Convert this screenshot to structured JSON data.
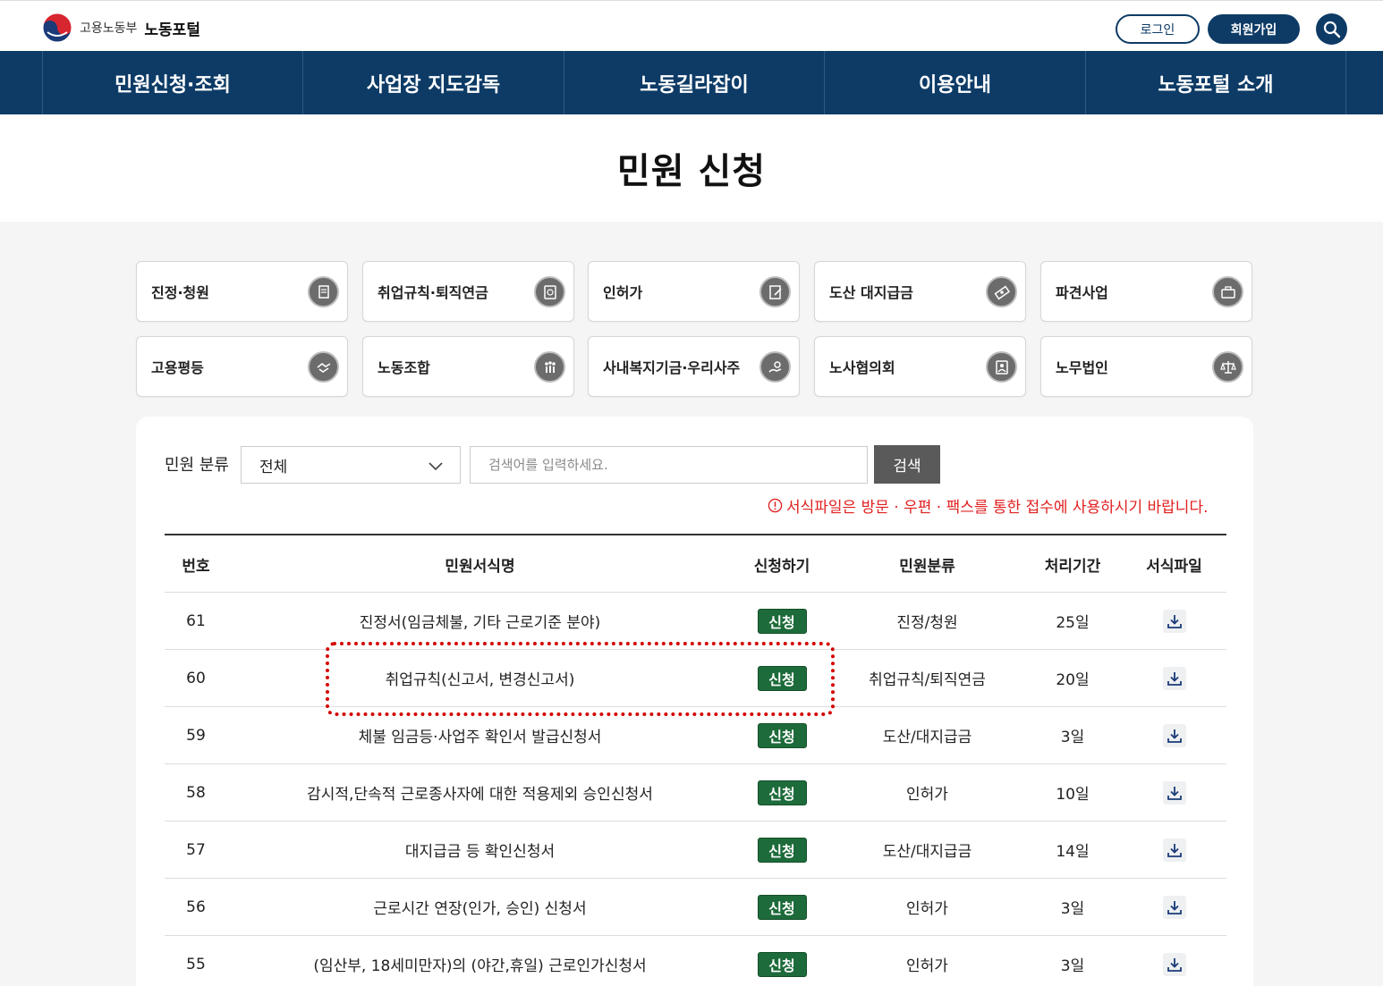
{
  "header": {
    "ministry": "고용노동부",
    "portal": "노동포털",
    "login_label": "로그인",
    "join_label": "회원가입",
    "search_icon": "search-icon"
  },
  "gnb": [
    "민원신청·조회",
    "사업장 지도감독",
    "노동길라잡이",
    "이용안내",
    "노동포털 소개"
  ],
  "page_title": "민원 신청",
  "categories": [
    {
      "label": "진정·청원",
      "icon": "petition-icon"
    },
    {
      "label": "취업규칙·퇴직연금",
      "icon": "rules-icon"
    },
    {
      "label": "인허가",
      "icon": "permit-icon"
    },
    {
      "label": "도산 대지급금",
      "icon": "money-icon"
    },
    {
      "label": "파견사업",
      "icon": "briefcase-icon"
    },
    {
      "label": "고용평등",
      "icon": "handshake-icon"
    },
    {
      "label": "노동조합",
      "icon": "union-icon"
    },
    {
      "label": "사내복지기금·우리사주",
      "icon": "welfare-icon"
    },
    {
      "label": "노사협의회",
      "icon": "council-icon"
    },
    {
      "label": "노무법인",
      "icon": "scale-icon"
    }
  ],
  "filter": {
    "label": "민원 분류",
    "selected": "전체",
    "placeholder": "검색어를 입력하세요.",
    "search_label": "검색"
  },
  "notice": "서식파일은 방문 · 우편 · 팩스를 통한 접수에 사용하시기 바랍니다.",
  "table": {
    "headers": [
      "번호",
      "민원서식명",
      "신청하기",
      "민원분류",
      "처리기간",
      "서식파일"
    ],
    "apply_label": "신청",
    "rows": [
      {
        "no": "61",
        "name": "진정서(임금체불, 기타 근로기준 분야)",
        "category": "진정/청원",
        "period": "25일"
      },
      {
        "no": "60",
        "name": "취업규칙(신고서, 변경신고서)",
        "category": "취업규칙/퇴직연금",
        "period": "20일"
      },
      {
        "no": "59",
        "name": "체불 임금등·사업주 확인서 발급신청서",
        "category": "도산/대지급금",
        "period": "3일"
      },
      {
        "no": "58",
        "name": "감시적,단속적 근로종사자에 대한 적용제외 승인신청서",
        "category": "인허가",
        "period": "10일"
      },
      {
        "no": "57",
        "name": "대지급금 등 확인신청서",
        "category": "도산/대지급금",
        "period": "14일"
      },
      {
        "no": "56",
        "name": "근로시간 연장(인가, 승인) 신청서",
        "category": "인허가",
        "period": "3일"
      },
      {
        "no": "55",
        "name": "(임산부, 18세미만자)의 (야간,휴일) 근로인가신청서",
        "category": "인허가",
        "period": "3일"
      }
    ]
  },
  "colors": {
    "navy": "#0d3b66",
    "apply_green": "#1d6b3a",
    "notice_red": "#e02020",
    "highlight_red": "#d40000"
  }
}
